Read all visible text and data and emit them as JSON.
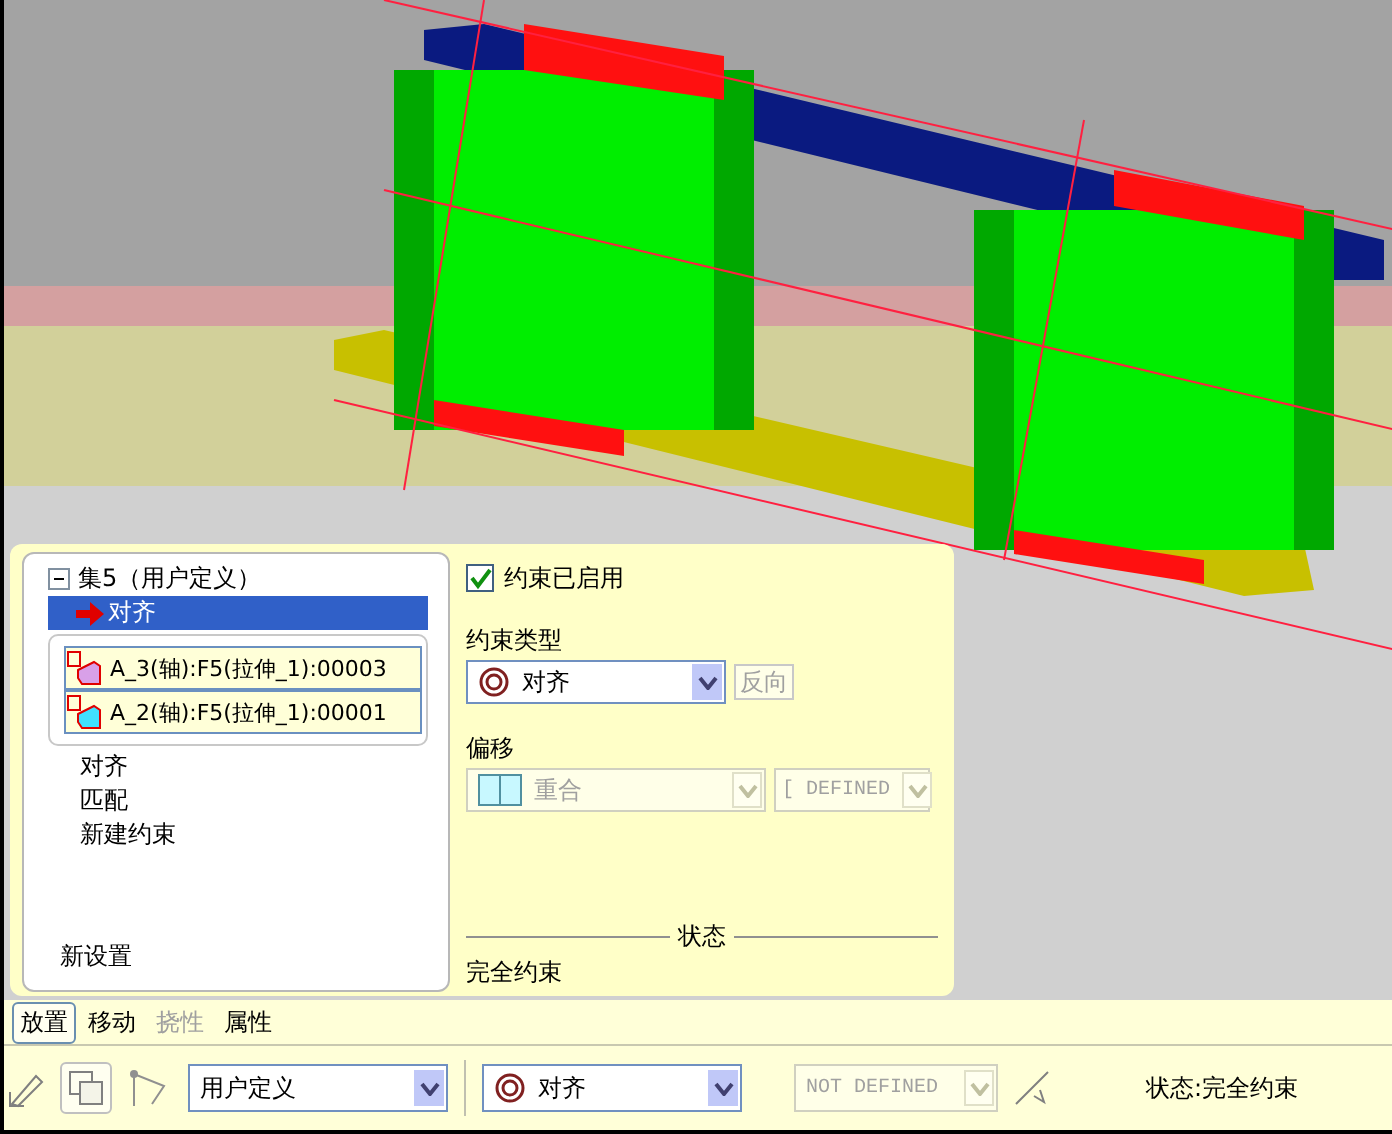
{
  "constraints_tree": {
    "set_label": "集5（用户定义）",
    "expanded": true,
    "constraints": [
      {
        "label": "对齐",
        "selected": true,
        "references": [
          "A_3(轴):F5(拉伸_1):00003",
          "A_2(轴):F5(拉伸_1):00001"
        ]
      },
      {
        "label": "对齐",
        "selected": false
      },
      {
        "label": "匹配",
        "selected": false
      },
      {
        "label": "新建约束",
        "selected": false
      }
    ],
    "new_set": "新设置"
  },
  "constraint_enabled": {
    "label": "约束已启用",
    "checked": true
  },
  "constraint_type": {
    "label": "约束类型",
    "value": "对齐",
    "flip_button": {
      "label": "反向",
      "disabled": true
    }
  },
  "offset": {
    "label": "偏移",
    "value": "重合",
    "unit": "[ DEFINED",
    "disabled": true
  },
  "status": {
    "heading": "状态",
    "text": "完全约束"
  },
  "tabs": [
    {
      "label": "放置",
      "selected": true,
      "disabled": false
    },
    {
      "label": "移动",
      "selected": false,
      "disabled": false
    },
    {
      "label": "挠性",
      "selected": false,
      "disabled": true
    },
    {
      "label": "属性",
      "selected": false,
      "disabled": false
    }
  ],
  "toolbar": {
    "set_type": "用户定义",
    "constraint": "对齐",
    "offset": "NOT DEFINED",
    "offset_disabled": true,
    "status": "状态:完全约束"
  }
}
